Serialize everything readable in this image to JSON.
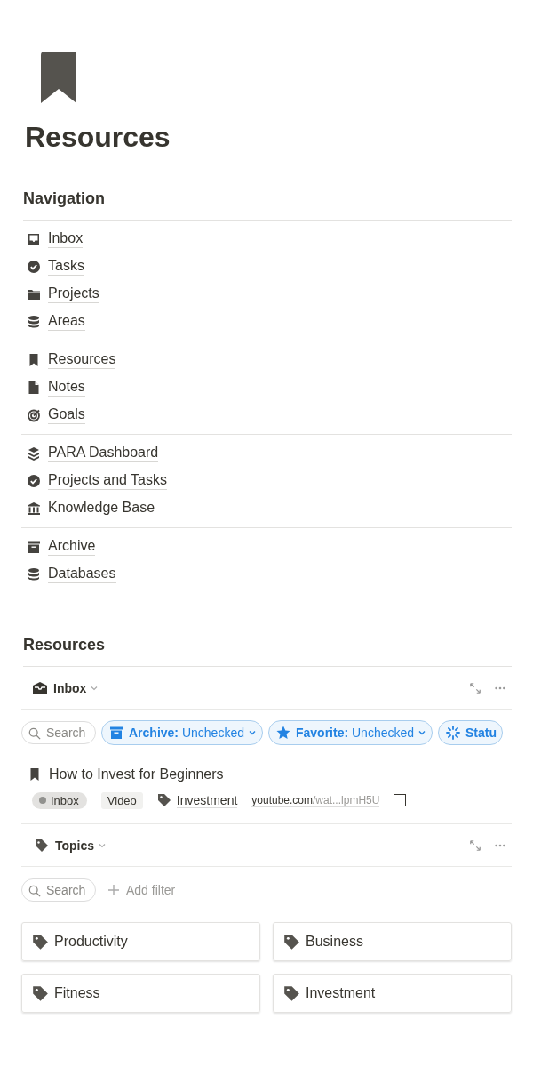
{
  "page": {
    "title": "Resources"
  },
  "navigation": {
    "heading": "Navigation",
    "groups": [
      [
        {
          "label": "Inbox"
        },
        {
          "label": "Tasks"
        },
        {
          "label": "Projects"
        },
        {
          "label": "Areas"
        }
      ],
      [
        {
          "label": "Resources"
        },
        {
          "label": "Notes"
        },
        {
          "label": "Goals"
        }
      ],
      [
        {
          "label": "PARA Dashboard"
        },
        {
          "label": "Projects and Tasks"
        },
        {
          "label": "Knowledge Base"
        }
      ],
      [
        {
          "label": "Archive"
        },
        {
          "label": "Databases"
        }
      ]
    ]
  },
  "resources": {
    "heading": "Resources",
    "inbox_view": {
      "title": "Inbox",
      "search": {
        "placeholder": "Search"
      },
      "filters": [
        {
          "label": "Archive:",
          "value": "Unchecked"
        },
        {
          "label": "Favorite:",
          "value": "Unchecked"
        },
        {
          "label": "Statu"
        }
      ],
      "items": [
        {
          "title": "How to Invest for Beginners",
          "status": "Inbox",
          "type": "Video",
          "topic": "Investment",
          "url_host": "youtube.com",
          "url_rest": "/wat...lpmH5U",
          "checked": false
        }
      ]
    },
    "topics_view": {
      "title": "Topics",
      "search": {
        "placeholder": "Search"
      },
      "add_filter": "Add filter",
      "cards": [
        {
          "label": "Productivity"
        },
        {
          "label": "Business"
        },
        {
          "label": "Fitness"
        },
        {
          "label": "Investment"
        }
      ]
    }
  }
}
